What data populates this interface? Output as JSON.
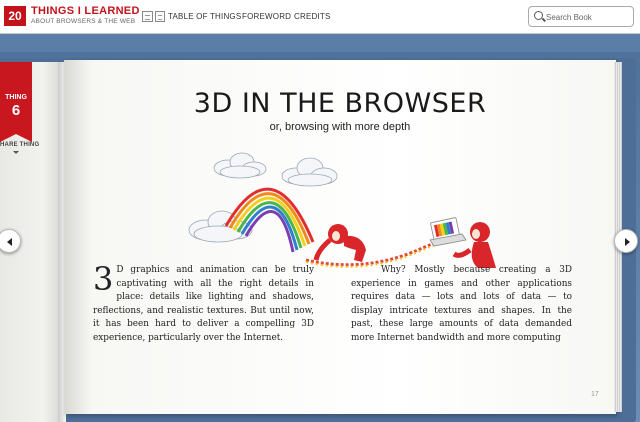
{
  "header": {
    "logo_number": "20",
    "logo_title": "THINGS I LEARNED",
    "logo_subtitle": "ABOUT BROWSERS & THE WEB",
    "nav": [
      "TABLE OF THINGS",
      "FOREWORD",
      "CREDITS"
    ],
    "search_placeholder": "Search Book"
  },
  "bookmark": {
    "label": "THING",
    "number": "6",
    "share": "HARE THING"
  },
  "page": {
    "title": "3D IN THE BROWSER",
    "subtitle": "or, browsing with more depth",
    "dropcap": "3",
    "col_left": "D graphics and animation can be truly captivating with all the right details in place: details like lighting and shadows, reflections, and realistic textures. But until now, it has been hard to deliver a compelling 3D experience, particularly over the Internet.",
    "col_right": "Why? Mostly because creating a 3D experience in games and other applications requires data — lots and lots of data — to display intricate textures and shapes. In the past, these large amounts of data demanded more Internet bandwidth and more computing",
    "page_number": "17"
  },
  "colors": {
    "brand_red": "#c4121b",
    "cover_blue": "#4c6e97"
  },
  "icons": [
    "table-of-things-icon",
    "search-icon",
    "arrow-left-icon",
    "arrow-right-icon"
  ]
}
